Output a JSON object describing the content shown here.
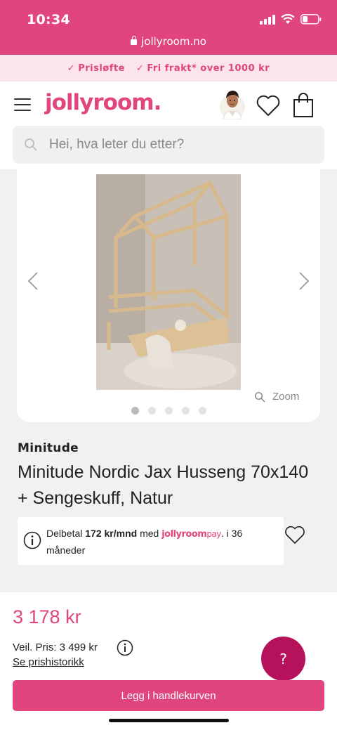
{
  "status_bar": {
    "time": "10:34",
    "url": "jollyroom.no"
  },
  "promo": {
    "items": [
      "Prisløfte",
      "Fri frakt* over 1000 kr"
    ]
  },
  "header": {
    "logo": "jollyroom.",
    "search_placeholder": "Hei, hva leter du etter?"
  },
  "gallery": {
    "zoom_label": "Zoom",
    "image_count": 5,
    "active_index": 0
  },
  "product": {
    "brand": "Minitude",
    "title": "Minitude Nordic Jax Husseng 70x140 + Sengeskuff, Natur"
  },
  "financing": {
    "prefix": "Delbetal",
    "amount": "172 kr/mnd",
    "mid": "med",
    "brand_jolly": "jollyroom",
    "brand_pay": "pay",
    "suffix": ". i 36 måneder"
  },
  "pricing": {
    "price": "3 178 kr",
    "recommended": "Veil. Pris: 3 499 kr",
    "history_link": "Se prishistorikk"
  },
  "help_button": "?",
  "cart_button": "Legg i handlekurven",
  "colors": {
    "brand": "#e0467d",
    "help": "#b5125b",
    "promo_bg": "#fbe5ea"
  }
}
